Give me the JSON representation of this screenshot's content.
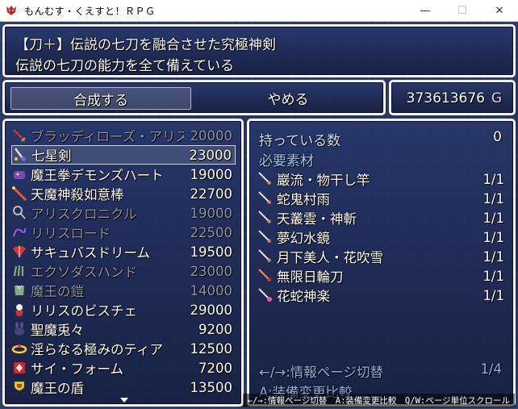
{
  "window": {
    "title": "もんむす・くえすと！ＲＰＧ",
    "icons": {
      "app": "demon-app-icon",
      "minimize": "minimize-icon",
      "maximize": "maximize-icon",
      "close": "close-icon"
    }
  },
  "help": {
    "line1": "【刀＋】伝説の七刀を融合させた究極神剣",
    "line2": "伝説の七刀の能力を全て備えている"
  },
  "command": {
    "compose": "合成する",
    "cancel": "やめる"
  },
  "gold": {
    "value": "373613676",
    "unit": "G"
  },
  "items": [
    {
      "name": "ブラッディローズ・アリス",
      "price": "20000",
      "dim": true,
      "icon": "sword-icon"
    },
    {
      "name": "七星剣",
      "price": "23000",
      "dim": false,
      "icon": "star-sword-icon",
      "selected": true
    },
    {
      "name": "魔王拳デモンズハート",
      "price": "19000",
      "dim": false,
      "icon": "demon-fist-icon"
    },
    {
      "name": "天魔神殺如意棒",
      "price": "22700",
      "dim": false,
      "icon": "staff-icon"
    },
    {
      "name": "アリスクロニクル",
      "price": "19000",
      "dim": true,
      "icon": "racket-icon"
    },
    {
      "name": "リリスロード",
      "price": "22500",
      "dim": true,
      "icon": "whip-icon"
    },
    {
      "name": "サキュバスドリーム",
      "price": "19500",
      "dim": false,
      "icon": "fan-icon"
    },
    {
      "name": "エクソダスハンド",
      "price": "23000",
      "dim": true,
      "icon": "claw-icon"
    },
    {
      "name": "魔王の鎧",
      "price": "14000",
      "dim": true,
      "icon": "armor-icon"
    },
    {
      "name": "リリスのビスチェ",
      "price": "29000",
      "dim": false,
      "icon": "bustier-icon"
    },
    {
      "name": "聖魔兎々",
      "price": "9200",
      "dim": false,
      "icon": "rabbit-icon"
    },
    {
      "name": "淫らなる極みのティア",
      "price": "12500",
      "dim": false,
      "icon": "tiara-icon"
    },
    {
      "name": "サイ・フォーム",
      "price": "7200",
      "dim": false,
      "icon": "form-icon"
    },
    {
      "name": "魔王の盾",
      "price": "13500",
      "dim": false,
      "icon": "shield-icon"
    }
  ],
  "detail": {
    "owned_label": "持っている数",
    "owned_value": "0",
    "required_label": "必要素材",
    "materials": [
      {
        "name": "巖流・物干し竿",
        "count": "1/1",
        "icon": "katana-icon"
      },
      {
        "name": "蛇鬼村雨",
        "count": "1/1",
        "icon": "katana-icon"
      },
      {
        "name": "天叢雲・神斬",
        "count": "1/1",
        "icon": "katana-icon"
      },
      {
        "name": "夢幻水鏡",
        "count": "1/1",
        "icon": "katana-icon"
      },
      {
        "name": "月下美人・花吹雪",
        "count": "1/1",
        "icon": "katana-icon"
      },
      {
        "name": "無限日輪刀",
        "count": "1/1",
        "icon": "fire-katana-icon"
      },
      {
        "name": "花蛇神楽",
        "count": "1/1",
        "icon": "flower-katana-icon"
      }
    ],
    "page_label": "←/→:情報ページ切替",
    "page_value": "1/4",
    "compare_label": "A:装備変更比較"
  },
  "hint": "←/→:情報ページ切替　A:装備変更比較　Q/W:ページ単位スクロール",
  "colors": {
    "window_border": "#f2f2f2",
    "window_bg": "#24325f",
    "dim_text": "#8e94a8",
    "label_blue": "#9fc6ff"
  }
}
